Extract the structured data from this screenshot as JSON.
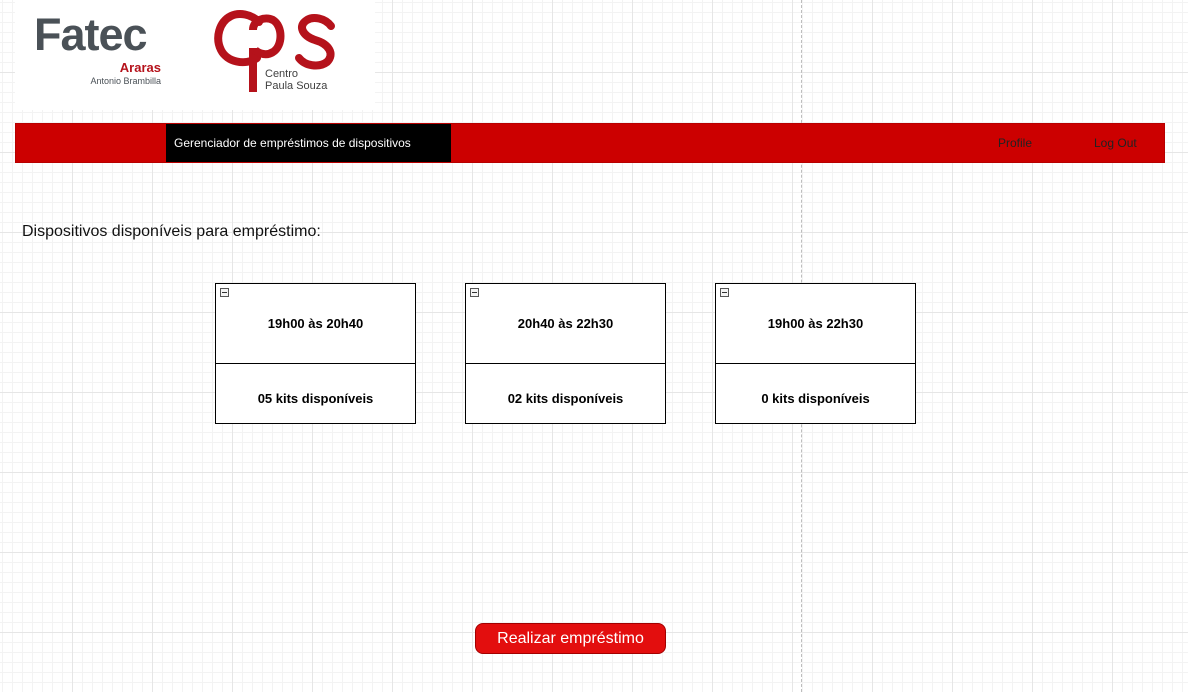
{
  "logos": {
    "fatec": {
      "word": "Fatec",
      "city": "Araras",
      "name": "Antonio Brambilla"
    },
    "cps": {
      "line1": "Centro",
      "line2": "Paula Souza"
    }
  },
  "nav": {
    "title": "Gerenciador de empréstimos de dispositivos",
    "profile_label": "Profile",
    "logout_label": "Log Out"
  },
  "main": {
    "heading": "Dispositivos disponíveis para empréstimo:",
    "slots": [
      {
        "time": "19h00 às 20h40",
        "kits": "05 kits disponíveis"
      },
      {
        "time": "20h40 às 22h30",
        "kits": "02 kits disponíveis"
      },
      {
        "time": "19h00 às 22h30",
        "kits": "0 kits disponíveis"
      }
    ],
    "button_label": "Realizar empréstimo"
  },
  "colors": {
    "nav_bar": "#cc0000",
    "nav_title_bg": "#000000",
    "button": "#e30e0e",
    "brand_red": "#b5121b",
    "brand_gray": "#4a5157"
  }
}
